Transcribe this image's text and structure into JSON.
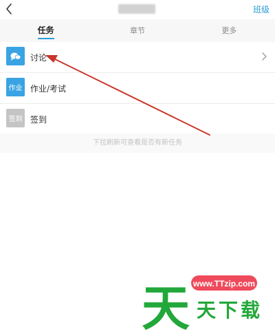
{
  "header": {
    "back_icon": "chevron-left-icon",
    "right_action": "班级"
  },
  "tabs": [
    {
      "label": "任务",
      "active": true
    },
    {
      "label": "章节",
      "active": false
    },
    {
      "label": "更多",
      "active": false
    }
  ],
  "list": [
    {
      "icon": "chat-bubble-icon",
      "icon_text": "",
      "label": "讨论",
      "color": "#3aa3e3",
      "has_chevron": true
    },
    {
      "icon": "homework-icon",
      "icon_text": "作业",
      "label": "作业/考试",
      "color": "#3aa3e3",
      "has_chevron": false
    },
    {
      "icon": "checkin-icon",
      "icon_text": "签到",
      "label": "签到",
      "color": "#c4c4c4",
      "has_chevron": false
    }
  ],
  "hint": "下拉刷新可查看是否有新任务",
  "colors": {
    "accent": "#2b9bd7",
    "annotation": "#c8352b",
    "watermark_green": "#22a83a",
    "watermark_pill": "#ef4b5c"
  },
  "watermark": {
    "url": "www.TTzip.com",
    "main_char": "天",
    "chars": [
      "天",
      "下",
      "载"
    ]
  }
}
